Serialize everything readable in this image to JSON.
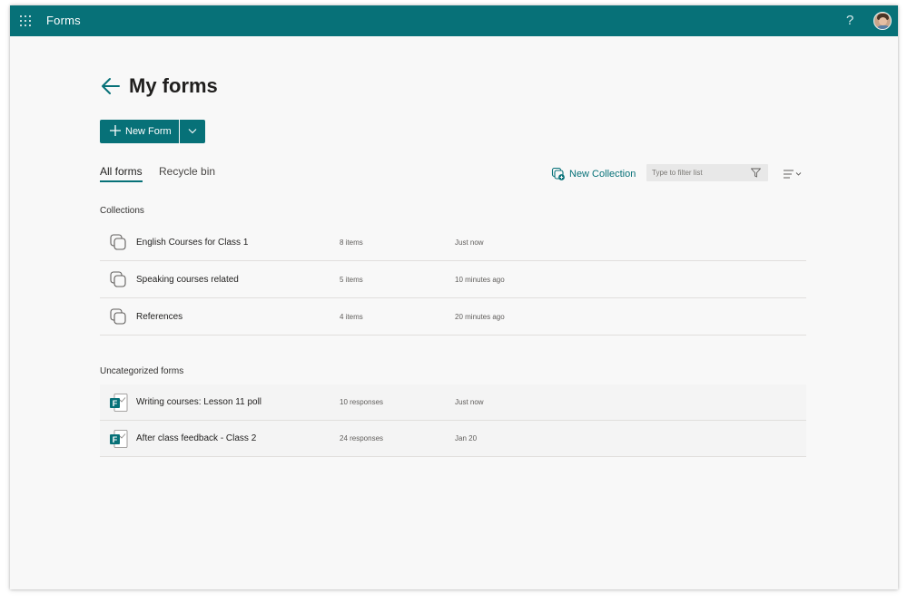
{
  "app": {
    "name": "Forms",
    "accent": "#077178"
  },
  "header": {
    "help_label": "?",
    "avatar_alt": "User profile"
  },
  "page": {
    "title": "My forms"
  },
  "toolbar": {
    "new_form_label": "New Form"
  },
  "tabs": [
    {
      "label": "All forms",
      "active": true
    },
    {
      "label": "Recycle bin",
      "active": false
    }
  ],
  "actions": {
    "new_collection_label": "New Collection",
    "filter_placeholder": "Type to filter list"
  },
  "collections": {
    "heading": "Collections",
    "items": [
      {
        "name": "English Courses for Class 1",
        "count": "8 items",
        "modified": "Just now"
      },
      {
        "name": "Speaking courses related",
        "count": "5 items",
        "modified": "10 minutes ago"
      },
      {
        "name": "References",
        "count": "4 items",
        "modified": "20 minutes ago"
      }
    ]
  },
  "uncategorized": {
    "heading": "Uncategorized forms",
    "items": [
      {
        "name": "Writing courses: Lesson 11 poll",
        "count": "10 responses",
        "modified": "Just now"
      },
      {
        "name": "After class feedback - Class 2",
        "count": "24 responses",
        "modified": "Jan 20"
      }
    ]
  }
}
